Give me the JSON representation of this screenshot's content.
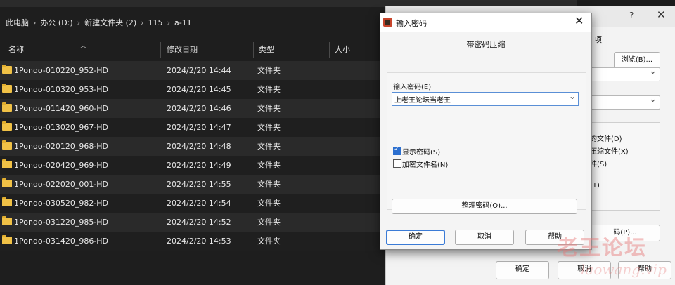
{
  "explorer": {
    "breadcrumb": [
      "此电脑",
      "办公 (D:)",
      "新建文件夹 (2)",
      "115",
      "a-11"
    ],
    "breadcrumb_separator": "›",
    "columns": {
      "name": "名称",
      "date": "修改日期",
      "type": "类型",
      "size": "大小"
    },
    "rows": [
      {
        "name": "1Pondo-010220_952-HD",
        "date": "2024/2/20 14:44",
        "type": "文件夹"
      },
      {
        "name": "1Pondo-010320_953-HD",
        "date": "2024/2/20 14:45",
        "type": "文件夹"
      },
      {
        "name": "1Pondo-011420_960-HD",
        "date": "2024/2/20 14:46",
        "type": "文件夹"
      },
      {
        "name": "1Pondo-013020_967-HD",
        "date": "2024/2/20 14:47",
        "type": "文件夹"
      },
      {
        "name": "1Pondo-020120_968-HD",
        "date": "2024/2/20 14:48",
        "type": "文件夹"
      },
      {
        "name": "1Pondo-020420_969-HD",
        "date": "2024/2/20 14:49",
        "type": "文件夹"
      },
      {
        "name": "1Pondo-022020_001-HD",
        "date": "2024/2/20 14:55",
        "type": "文件夹"
      },
      {
        "name": "1Pondo-030520_982-HD",
        "date": "2024/2/20 14:54",
        "type": "文件夹"
      },
      {
        "name": "1Pondo-031220_985-HD",
        "date": "2024/2/20 14:52",
        "type": "文件夹"
      },
      {
        "name": "1Pondo-031420_986-HD",
        "date": "2024/2/20 14:53",
        "type": "文件夹"
      }
    ]
  },
  "background_dialog": {
    "help_glyph": "?",
    "close_glyph": "✕",
    "tab_label": "项",
    "browse_button": "浏览(B)...",
    "options": [
      "的文件(D)",
      "压缩文件(X)",
      "件(S)",
      ")",
      "(T)"
    ],
    "set_button": "码(P)...",
    "ok_button": "确定",
    "cancel_button": "取消",
    "help_button": "帮助"
  },
  "password_dialog": {
    "title": "输入密码",
    "close_glyph": "✕",
    "heading": "带密码压缩",
    "input_label": "输入密码(E)",
    "input_value": "上老王论坛当老王",
    "show_password_label": "显示密码(S)",
    "show_password_checked": true,
    "encrypt_names_label": "加密文件名(N)",
    "encrypt_names_checked": false,
    "manage_button": "整理密码(O)...",
    "ok_button": "确定",
    "cancel_button": "取消",
    "help_button": "帮助"
  },
  "watermark": {
    "text": "老王论坛",
    "url_text": "laowang.vip",
    "color": "#e67878"
  }
}
